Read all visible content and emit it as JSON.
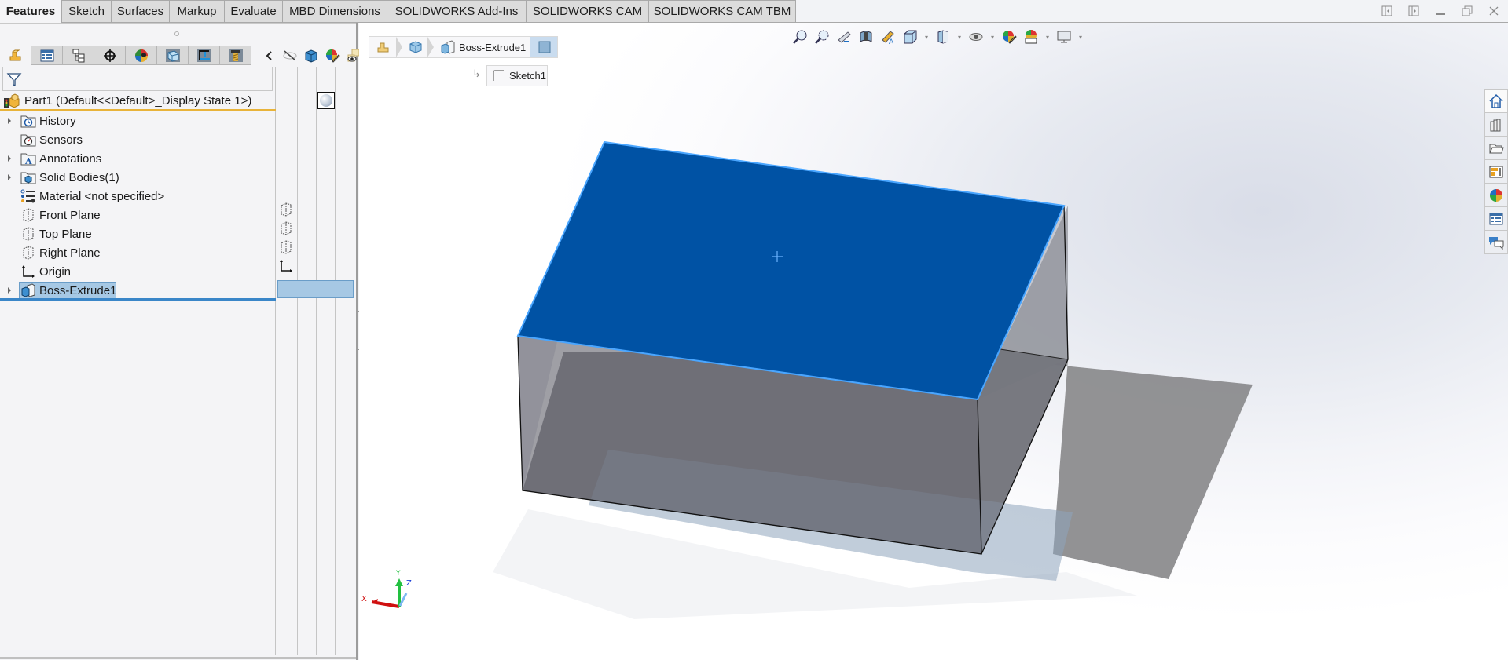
{
  "command_tabs": [
    {
      "label": "Features",
      "active": true
    },
    {
      "label": "Sketch"
    },
    {
      "label": "Surfaces"
    },
    {
      "label": "Markup"
    },
    {
      "label": "Evaluate"
    },
    {
      "label": "MBD Dimensions"
    },
    {
      "label": "SOLIDWORKS Add-Ins"
    },
    {
      "label": "SOLIDWORKS CAM"
    },
    {
      "label": "SOLIDWORKS CAM TBM"
    }
  ],
  "window_controls": [
    "dock-left-icon",
    "dock-right-icon",
    "minimize-icon",
    "restore-icon",
    "close-icon"
  ],
  "feature_manager": {
    "tabs": [
      "featuremanager-tree-icon",
      "propertymanager-icon",
      "configurationmanager-icon",
      "dimxpertmanager-icon",
      "displaymanager-icon",
      "cam-feature-tree-icon",
      "cam-operation-tree-icon",
      "cam-tool-tree-icon"
    ],
    "tools": [
      "collapse-arrow-icon",
      "hide-show-icon",
      "display-style-icon",
      "edit-appearance-icon",
      "view-settings-icon"
    ],
    "part": {
      "label": "Part1  (Default<<Default>_Display State 1>)"
    },
    "tree": [
      {
        "label": "History",
        "icon": "history-folder-icon",
        "expandable": true
      },
      {
        "label": "Sensors",
        "icon": "sensors-folder-icon",
        "expandable": false
      },
      {
        "label": "Annotations",
        "icon": "annotations-folder-icon",
        "expandable": true
      },
      {
        "label": "Solid Bodies(1)",
        "icon": "solid-bodies-folder-icon",
        "expandable": true
      },
      {
        "label": "Material <not specified>",
        "icon": "material-icon",
        "expandable": false
      },
      {
        "label": "Front Plane",
        "icon": "plane-icon",
        "expandable": false
      },
      {
        "label": "Top Plane",
        "icon": "plane-icon",
        "expandable": false
      },
      {
        "label": "Right Plane",
        "icon": "plane-icon",
        "expandable": false
      },
      {
        "label": "Origin",
        "icon": "origin-icon",
        "expandable": false
      },
      {
        "label": "Boss-Extrude1",
        "icon": "extrude-icon",
        "expandable": true,
        "selected": true
      }
    ]
  },
  "breadcrumb": {
    "items": [
      "part-icon",
      "solid-body-icon",
      "Boss-Extrude1",
      "face-icon"
    ],
    "feature_label": "Boss-Extrude1",
    "child_label": "Sketch1"
  },
  "heads_up_toolbar": [
    "zoom-to-fit-icon",
    "zoom-to-area-icon",
    "previous-view-icon",
    "section-view-icon",
    "dynamic-annotation-views-icon",
    "view-orientation-icon",
    "display-style-icon",
    "hide-show-items-icon",
    "edit-appearance-icon",
    "apply-scene-icon",
    "view-settings-icon"
  ],
  "task_pane": [
    "solidworks-resources-icon",
    "design-library-icon",
    "file-explorer-icon",
    "view-palette-icon",
    "appearances-scenes-icon",
    "custom-properties-icon",
    "forum-icon"
  ],
  "triad": {
    "x_label": "X",
    "y_label": "Y",
    "z_label": "Z"
  },
  "colors": {
    "selected_face": "#0052a4",
    "selected_edge": "#4aa6ff",
    "tree_selection": "#a6c8e4",
    "rollback_bar": "#3a86c8",
    "config_bar": "#e8b33a"
  }
}
